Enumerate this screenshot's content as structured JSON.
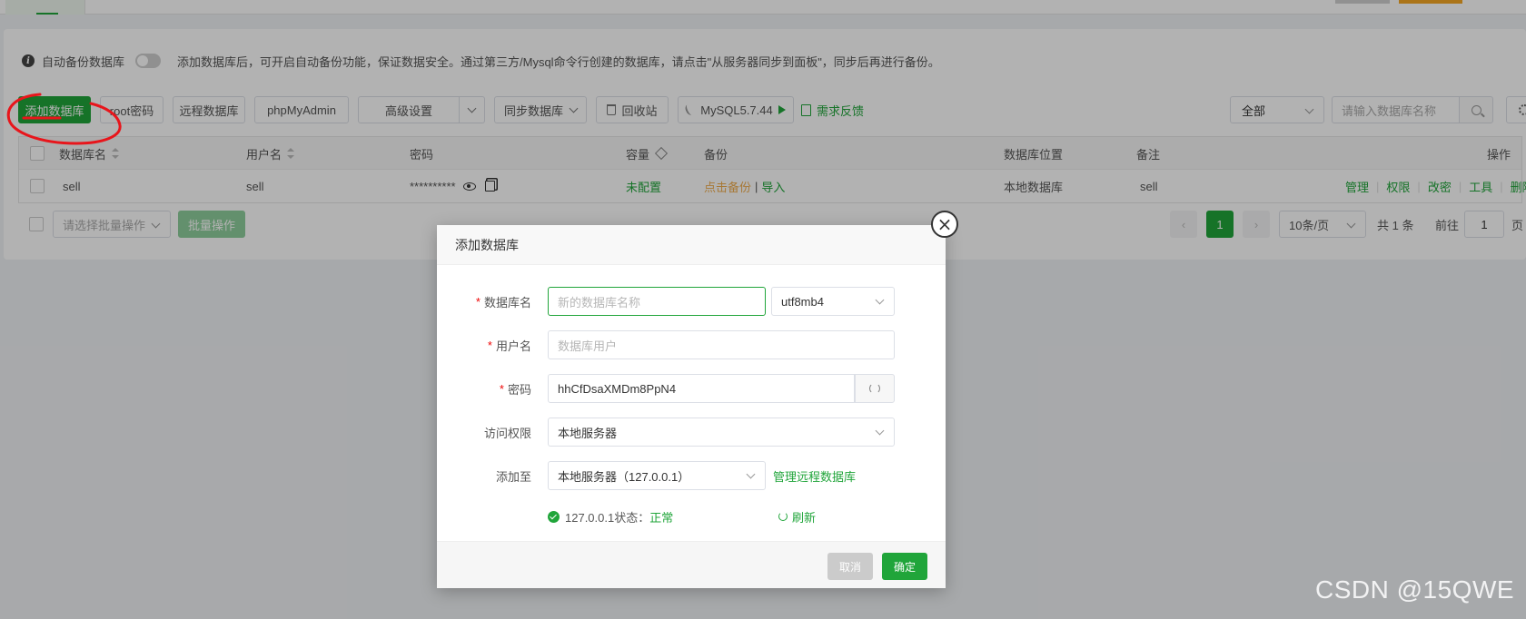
{
  "notice": {
    "auto_backup_label": "自动备份数据库",
    "auto_backup_on": false,
    "text": "添加数据库后，可开启自动备份功能，保证数据安全。通过第三方/Mysql命令行创建的数据库，请点击\"从服务器同步到面板\"，同步后再进行备份。"
  },
  "toolbar": {
    "add_db": "添加数据库",
    "root_pwd": "root密码",
    "remote_db": "远程数据库",
    "phpmyadmin": "phpMyAdmin",
    "advanced": "高级设置",
    "sync_db": "同步数据库",
    "recycle": "回收站",
    "mysql_version": "MySQL5.7.44",
    "feedback": "需求反馈",
    "filter_value": "全部",
    "search_placeholder": "请输入数据库名称"
  },
  "table": {
    "headers": {
      "name": "数据库名",
      "user": "用户名",
      "password": "密码",
      "capacity": "容量",
      "backup": "备份",
      "location": "数据库位置",
      "note": "备注",
      "ops": "操作"
    },
    "rows": [
      {
        "name": "sell",
        "user": "sell",
        "password": "**********",
        "capacity": "未配置",
        "backup_click": "点击备份",
        "backup_sep": "|",
        "backup_import": "导入",
        "location": "本地数据库",
        "note": "sell",
        "ops": [
          "管理",
          "权限",
          "改密",
          "工具",
          "删除"
        ]
      }
    ]
  },
  "footer": {
    "batch_placeholder": "请选择批量操作",
    "batch_btn": "批量操作",
    "prev": "‹",
    "page": "1",
    "next": "›",
    "page_size": "10条/页",
    "total": "共 1 条",
    "goto_label": "前往",
    "goto_value": "1",
    "goto_unit": "页"
  },
  "modal": {
    "title": "添加数据库",
    "close": "×",
    "fields": {
      "name_label": "数据库名",
      "name_placeholder": "新的数据库名称",
      "charset": "utf8mb4",
      "user_label": "用户名",
      "user_placeholder": "数据库用户",
      "pwd_label": "密码",
      "pwd_value": "hhCfDsaXMDm8PpN4",
      "access_label": "访问权限",
      "access_value": "本地服务器",
      "addto_label": "添加至",
      "addto_value": "本地服务器（127.0.0.1）",
      "manage_remote": "管理远程数据库"
    },
    "status_prefix": "127.0.0.1状态：",
    "status_value": "正常",
    "refresh": "刷新",
    "cancel": "取消",
    "confirm": "确定",
    "required_mark": "*"
  },
  "watermark": "CSDN @15QWE",
  "colors": {
    "accent": "#20a53a",
    "annotation": "#e8151b"
  }
}
